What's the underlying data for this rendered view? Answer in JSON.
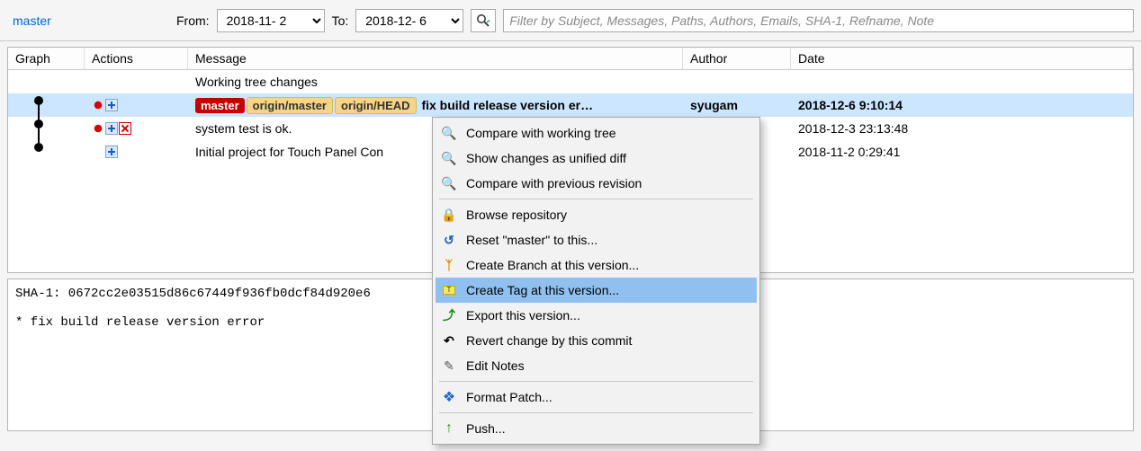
{
  "toolbar": {
    "branch": "master",
    "from_label": "From:",
    "to_label": "To:",
    "from_value": "2018-11- 2",
    "to_value": "2018-12- 6",
    "filter_placeholder": "Filter by Subject, Messages, Paths, Authors, Emails, SHA-1, Refname, Note"
  },
  "headers": {
    "graph": "Graph",
    "actions": "Actions",
    "message": "Message",
    "author": "Author",
    "date": "Date"
  },
  "working_label": "Working tree changes",
  "rows": [
    {
      "refs": [
        "master",
        "origin/master",
        "origin/HEAD"
      ],
      "message": "fix build release version er…",
      "author": "syugam",
      "date": "2018-12-6 9:10:14",
      "selected": true,
      "bold": true
    },
    {
      "refs": [],
      "message": "system test is ok.",
      "author": "",
      "date": "2018-12-3 23:13:48",
      "selected": false,
      "bold": false
    },
    {
      "refs": [],
      "message": "Initial project for Touch Panel Con",
      "author": "",
      "date": "2018-11-2 0:29:41",
      "selected": false,
      "bold": false
    }
  ],
  "details": {
    "line1": "SHA-1: 0672cc2e03515d86c67449f936fb0dcf84d920e6",
    "line2": "* fix build release version error"
  },
  "context_menu": {
    "items": [
      {
        "icon": "magnifier-icon",
        "label": "Compare with working tree"
      },
      {
        "icon": "magnifier-icon",
        "label": "Show changes as unified diff"
      },
      {
        "icon": "magnifier-icon",
        "label": "Compare with previous revision"
      },
      {
        "sep": true
      },
      {
        "icon": "browse-icon",
        "label": "Browse repository"
      },
      {
        "icon": "undo-icon",
        "label": "Reset \"master\" to this..."
      },
      {
        "icon": "branch-icon",
        "label": "Create Branch at this version..."
      },
      {
        "icon": "tag-icon",
        "label": "Create Tag at this version...",
        "highlight": true
      },
      {
        "icon": "export-icon",
        "label": "Export this version..."
      },
      {
        "icon": "revert-icon",
        "label": "Revert change by this commit"
      },
      {
        "icon": "edit-icon",
        "label": "Edit Notes"
      },
      {
        "sep": true
      },
      {
        "icon": "patch-icon",
        "label": "Format Patch..."
      },
      {
        "sep": true
      },
      {
        "icon": "push-icon",
        "label": "Push..."
      }
    ]
  }
}
